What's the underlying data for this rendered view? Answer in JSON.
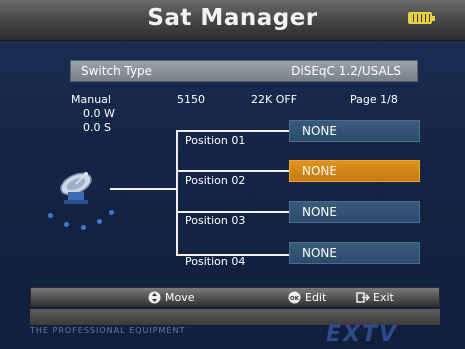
{
  "header": {
    "title": "Sat Manager",
    "battery_icon": "battery-icon"
  },
  "switch_type": {
    "label": "Switch Type",
    "value": "DiSEqC 1.2/USALS"
  },
  "info": {
    "mode": "Manual",
    "lnb": "5150",
    "tone": "22K OFF",
    "page": "Page 1/8",
    "longitude": "0.0 W",
    "latitude": "0.0 S"
  },
  "positions": [
    {
      "label": "Position 01",
      "value": "NONE",
      "selected": false
    },
    {
      "label": "Position 02",
      "value": "NONE",
      "selected": true
    },
    {
      "label": "Position 03",
      "value": "NONE",
      "selected": false
    },
    {
      "label": "Position 04",
      "value": "NONE",
      "selected": false
    }
  ],
  "footer": {
    "move": "Move",
    "ok_badge": "OK",
    "edit": "Edit",
    "exit": "Exit"
  },
  "brand": {
    "tagline": "THE PROFESSIONAL EQUIPMENT",
    "logo": "EXTV"
  },
  "colors": {
    "accent": "#e0921c",
    "box": "#2c4a6c",
    "battery": "#e8d23a"
  }
}
